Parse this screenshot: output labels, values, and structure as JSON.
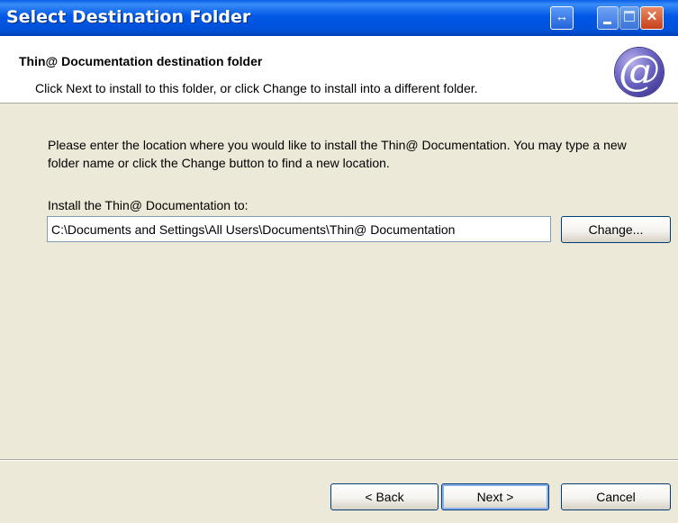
{
  "window": {
    "title": "Select Destination Folder",
    "controls": {
      "resize_icon": "resize-arrows-icon",
      "minimize_icon": "minimize-icon",
      "maximize_icon": "maximize-icon",
      "close_icon": "close-icon",
      "resize_glyph": "↔",
      "close_glyph": "✕"
    }
  },
  "header": {
    "title": "Thin@ Documentation destination folder",
    "subtitle": "Click Next to install to this folder, or click Change to install into a different folder.",
    "logo_glyph": "@"
  },
  "body": {
    "instructions": "Please enter the location where you would like to install the Thin@ Documentation. You may type a new folder name or click the Change button to find a new location.",
    "install_label": "Install the Thin@ Documentation to:",
    "install_path": "C:\\Documents and Settings\\All Users\\Documents\\Thin@ Documentation",
    "change_label": "Change..."
  },
  "footer": {
    "back_label": "< Back",
    "next_label": "Next >",
    "cancel_label": "Cancel"
  },
  "colors": {
    "titlebar": "#0058E6",
    "dialog_bg": "#ECE9D8",
    "close_button": "#C6401B"
  }
}
